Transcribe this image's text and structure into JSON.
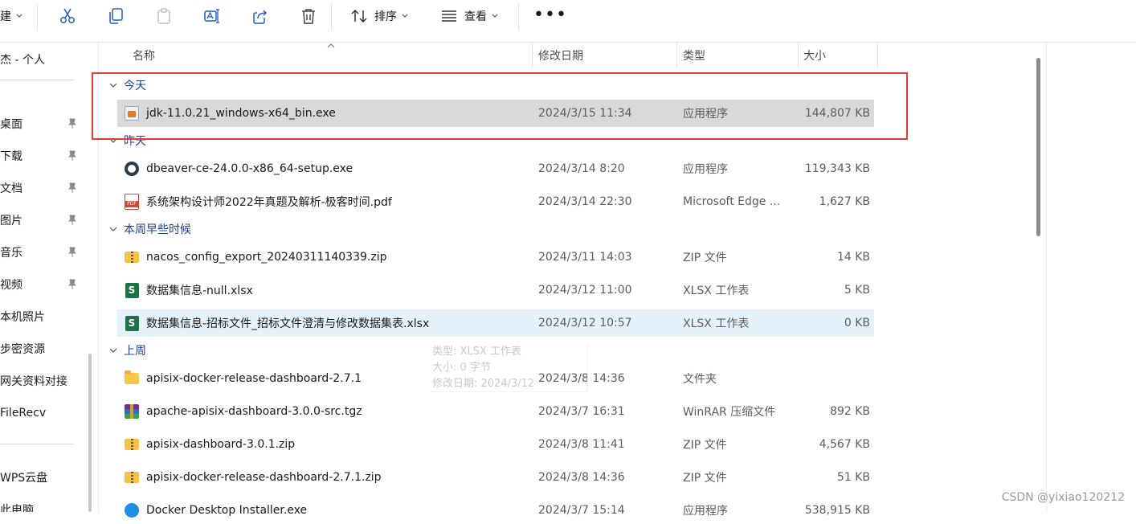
{
  "toolbar": {
    "new_label": "建",
    "sort_label": "排序",
    "view_label": "查看",
    "more_label": "•••"
  },
  "sidebar": {
    "user_item": "杰 - 个人",
    "pinned": [
      {
        "label": "桌面"
      },
      {
        "label": "下载"
      },
      {
        "label": "文档"
      },
      {
        "label": "图片"
      },
      {
        "label": "音乐"
      },
      {
        "label": "视频"
      }
    ],
    "others": [
      {
        "label": "本机照片"
      },
      {
        "label": "步密资源"
      },
      {
        "label": "网关资料对接"
      },
      {
        "label": "FileRecv"
      }
    ],
    "bottom": [
      {
        "label": "WPS云盘"
      },
      {
        "label": "此电脑"
      }
    ]
  },
  "columns": {
    "name": "名称",
    "date": "修改日期",
    "type": "类型",
    "size": "大小"
  },
  "groups": [
    {
      "label": "今天",
      "files": [
        {
          "name": "jdk-11.0.21_windows-x64_bin.exe",
          "date": "2024/3/15 11:34",
          "type": "应用程序",
          "size": "144,807 KB",
          "icon": "installer-icon",
          "state": "selected"
        }
      ]
    },
    {
      "label": "昨天",
      "files": [
        {
          "name": "dbeaver-ce-24.0.0-x86_64-setup.exe",
          "date": "2024/3/14 8:20",
          "type": "应用程序",
          "size": "119,343 KB",
          "icon": "dbeaver-icon",
          "state": ""
        },
        {
          "name": "系统架构设计师2022年真题及解析-极客时间.pdf",
          "date": "2024/3/14 22:30",
          "type": "Microsoft Edge ...",
          "size": "1,627 KB",
          "icon": "pdf-icon",
          "state": ""
        }
      ]
    },
    {
      "label": "本周早些时候",
      "files": [
        {
          "name": "nacos_config_export_20240311140339.zip",
          "date": "2024/3/11 14:03",
          "type": "ZIP 文件",
          "size": "14 KB",
          "icon": "zip-icon",
          "state": ""
        },
        {
          "name": "数据集信息-null.xlsx",
          "date": "2024/3/12 11:00",
          "type": "XLSX 工作表",
          "size": "5 KB",
          "icon": "xlsx-icon",
          "state": ""
        },
        {
          "name": "数据集信息-招标文件_招标文件澄清与修改数据集表.xlsx",
          "date": "2024/3/12 10:57",
          "type": "XLSX 工作表",
          "size": "0 KB",
          "icon": "xlsx-icon",
          "state": "hover"
        }
      ]
    },
    {
      "label": "上周",
      "files": [
        {
          "name": "apisix-docker-release-dashboard-2.7.1",
          "date": "2024/3/8 14:36",
          "type": "文件夹",
          "size": "",
          "icon": "folder-icon",
          "state": ""
        },
        {
          "name": "apache-apisix-dashboard-3.0.0-src.tgz",
          "date": "2024/3/7 16:31",
          "type": "WinRAR 压缩文件",
          "size": "892 KB",
          "icon": "winrar-icon",
          "state": ""
        },
        {
          "name": "apisix-dashboard-3.0.1.zip",
          "date": "2024/3/8 11:41",
          "type": "ZIP 文件",
          "size": "4,567 KB",
          "icon": "zip-icon",
          "state": ""
        },
        {
          "name": "apisix-docker-release-dashboard-2.7.1.zip",
          "date": "2024/3/8 14:36",
          "type": "ZIP 文件",
          "size": "51 KB",
          "icon": "zip-icon",
          "state": ""
        },
        {
          "name": "Docker Desktop Installer.exe",
          "date": "2024/3/7 15:14",
          "type": "应用程序",
          "size": "538,915 KB",
          "icon": "docker-icon",
          "state": ""
        }
      ]
    }
  ],
  "tooltip": {
    "line1": "类型: XLSX 工作表",
    "line2": "大小: 0 字节",
    "line3": "修改日期: 2024/3/12"
  },
  "watermark": "CSDN @yixiao120212",
  "colors": {
    "highlight_box": "#e8393a",
    "selected_row": "#d9d9d9",
    "hover_row": "#e5f1fb",
    "group_header": "#1f3f8f"
  }
}
